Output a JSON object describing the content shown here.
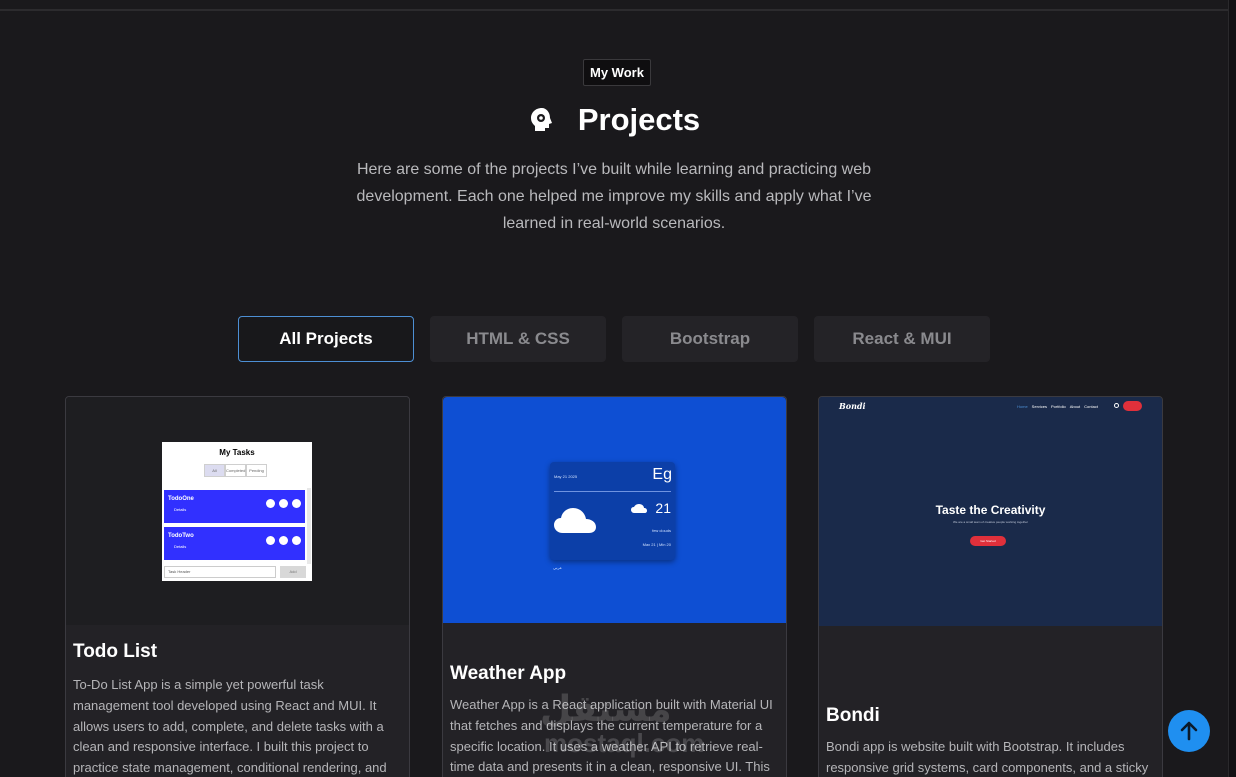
{
  "section": {
    "badge": "My Work",
    "title": "Projects",
    "description": "Here are some of the projects I’ve built while learning and practicing web development. Each one helped me improve my skills and apply what I’ve learned in real-world scenarios."
  },
  "filters": [
    {
      "label": "All Projects",
      "active": true
    },
    {
      "label": "HTML & CSS",
      "active": false
    },
    {
      "label": "Bootstrap",
      "active": false
    },
    {
      "label": "React & MUI",
      "active": false
    }
  ],
  "projects": [
    {
      "title": "Todo List",
      "description": "To-Do List App is a simple yet powerful task management tool developed using React and MUI. It allows users to add, complete, and delete tasks with a clean and responsive interface. I built this project to practice state management, conditional rendering, and component",
      "preview": {
        "heading": "My Tasks",
        "tabs": [
          "All",
          "Completed",
          "Pending"
        ],
        "items": [
          {
            "name": "TodoOne",
            "details": "Details"
          },
          {
            "name": "TodoTwo",
            "details": "Details"
          }
        ],
        "input_placeholder": "Task Header",
        "add_label": "Add"
      }
    },
    {
      "title": "Weather App",
      "description": "Weather App is a React application built with Material UI that fetches and displays the current temperature for a specific location. It uses a weather API to retrieve real-time data and presents it in a clean, responsive UI. This",
      "preview": {
        "date": "May 21 2025",
        "city": "Eg",
        "temp": "21",
        "desc": "few clouds",
        "minmax": "Max 21 | Min 20",
        "lang_toggle": "عربي"
      }
    },
    {
      "title": "Bondi",
      "description": "Bondi app is website built with Bootstrap. It includes responsive grid systems, card components, and a sticky",
      "preview": {
        "logo": "Bondi",
        "nav": [
          "Home",
          "Services",
          "Portfolio",
          "About",
          "Contact"
        ],
        "hero": "Taste the Creativity",
        "sub": "We are a small team of creative people working together",
        "cta": "Get Started"
      }
    }
  ],
  "watermark": {
    "text": "مستقل",
    "sub": "mostaql.com"
  },
  "colors": {
    "accent": "#4d8fd4",
    "scroll_top": "#1f8ff0",
    "bg": "#1a191c"
  }
}
